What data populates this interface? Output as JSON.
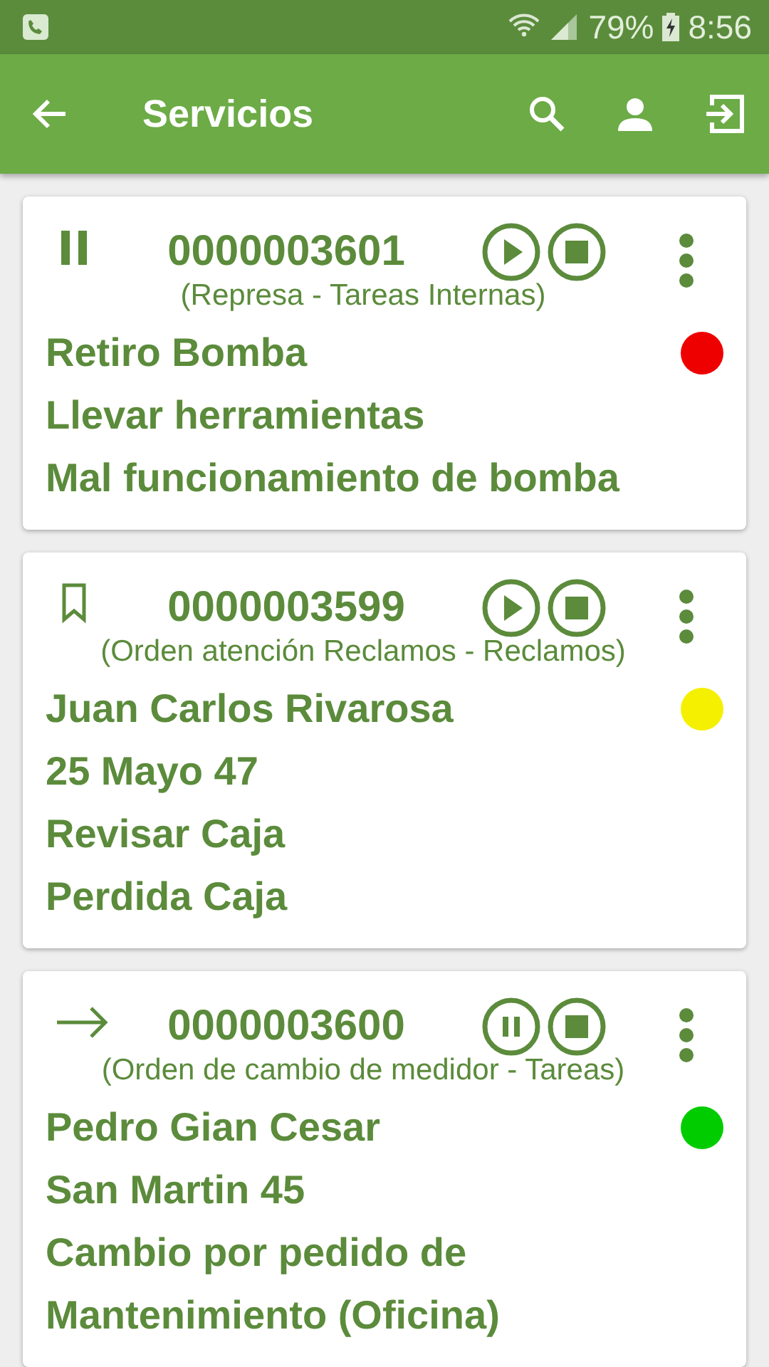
{
  "status_bar": {
    "battery": "79%",
    "time": "8:56"
  },
  "app_bar": {
    "title": "Servicios"
  },
  "services": [
    {
      "status_icon": {
        "kind": "paused"
      },
      "number": "0000003601",
      "subtitle": "(Represa - Tareas Internas)",
      "action_button": {
        "kind": "play"
      },
      "color": "#ee0000",
      "lines": [
        "Retiro Bomba",
        "Llevar herramientas",
        "Mal funcionamiento de bomba"
      ]
    },
    {
      "status_icon": {
        "kind": "bookmark"
      },
      "number": "0000003599",
      "subtitle": "(Orden atención Reclamos - Reclamos)",
      "action_button": {
        "kind": "play"
      },
      "color": "#f5f000",
      "lines": [
        "Juan Carlos Rivarosa",
        "25 Mayo 47",
        "Revisar Caja",
        "Perdida Caja"
      ]
    },
    {
      "status_icon": {
        "kind": "arrow"
      },
      "number": "0000003600",
      "subtitle": "(Orden de cambio de medidor - Tareas)",
      "action_button": {
        "kind": "pause"
      },
      "color": "#00cc00",
      "lines": [
        "Pedro Gian Cesar",
        "San Martin 45",
        "Cambio por pedido de Mantenimiento (Oficina)"
      ]
    }
  ]
}
